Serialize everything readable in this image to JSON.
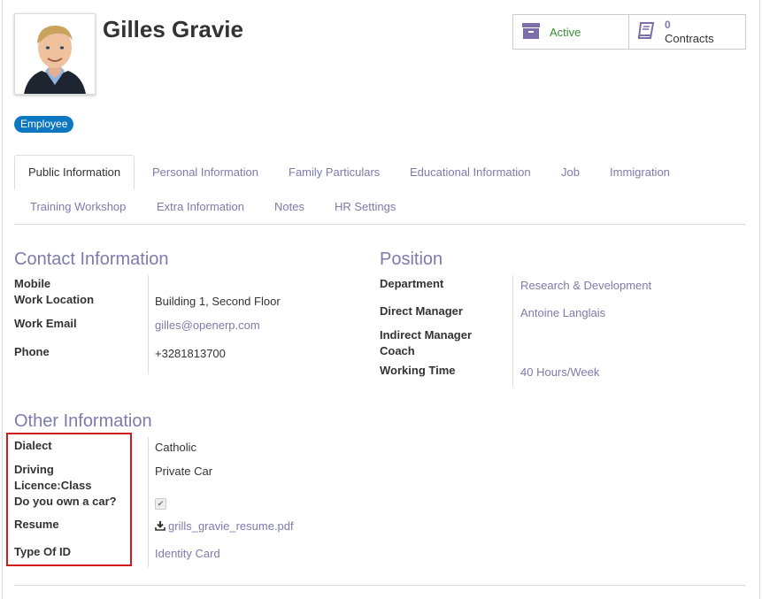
{
  "employee": {
    "name": "Gilles Gravie",
    "tag": "Employee"
  },
  "stats": {
    "active_label": "Active",
    "contracts_count": "0",
    "contracts_label": "Contracts"
  },
  "tabs": [
    {
      "label": "Public Information"
    },
    {
      "label": "Personal Information"
    },
    {
      "label": "Family Particulars"
    },
    {
      "label": "Educational Information"
    },
    {
      "label": "Job"
    },
    {
      "label": "Immigration"
    },
    {
      "label": "Training Workshop"
    },
    {
      "label": "Extra Information"
    },
    {
      "label": "Notes"
    },
    {
      "label": "HR Settings"
    }
  ],
  "contact": {
    "title": "Contact Information",
    "mobile_label": "Mobile",
    "work_location_label": "Work Location",
    "work_location": "Building 1, Second Floor",
    "work_email_label": "Work Email",
    "work_email": "gilles@openerp.com",
    "phone_label": "Phone",
    "phone": "+3281813700"
  },
  "position": {
    "title": "Position",
    "department_label": "Department",
    "department": "Research & Development",
    "direct_manager_label": "Direct Manager",
    "direct_manager": "Antoine Langlais",
    "indirect_manager_label": "Indirect Manager",
    "coach_label": "Coach",
    "working_time_label": "Working Time",
    "working_time": "40 Hours/Week"
  },
  "other": {
    "title": "Other Information",
    "dialect_label": "Dialect",
    "dialect": "Catholic",
    "driving_label_1": "Driving",
    "driving_label_2": "Licence:Class",
    "driving": "Private Car",
    "own_car_label": "Do you own a car?",
    "resume_label": "Resume",
    "resume": "grills_gravie_resume.pdf",
    "id_type_label": "Type Of ID",
    "id_type": "Identity Card"
  },
  "colors": {
    "accent": "#7c7bad",
    "badge": "#0d78c1",
    "active": "#3b8c3b",
    "highlight": "#d01b1b"
  },
  "icons": {
    "archive": "archive-icon",
    "book": "book-icon",
    "download": "download-icon",
    "check": "check-icon"
  }
}
